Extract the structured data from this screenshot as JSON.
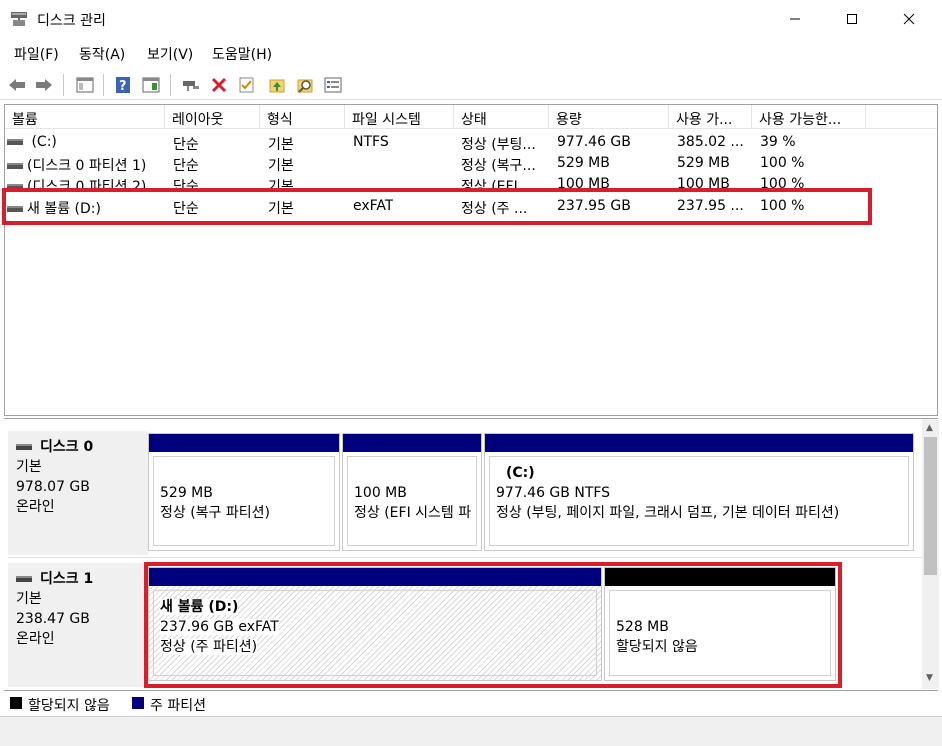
{
  "window": {
    "title": "디스크 관리"
  },
  "menu": [
    "파일(F)",
    "동작(A)",
    "보기(V)",
    "도움말(H)"
  ],
  "columns": [
    "볼륨",
    "레이아웃",
    "형식",
    "파일 시스템",
    "상태",
    "용량",
    "사용 가...",
    "사용 가능한..."
  ],
  "volumes": [
    {
      "name": "(C:)",
      "layout": "단순",
      "type": "기본",
      "fs": "NTFS",
      "status": "정상 (부팅...",
      "capacity": "977.46 GB",
      "free": "385.02 ...",
      "pct": "39 %"
    },
    {
      "name": "(디스크 0 파티션 1)",
      "layout": "단순",
      "type": "기본",
      "fs": "",
      "status": "정상 (복구...",
      "capacity": "529 MB",
      "free": "529 MB",
      "pct": "100 %"
    },
    {
      "name": "(디스크 0 파티션 2)",
      "layout": "단순",
      "type": "기본",
      "fs": "",
      "status": "정상 (EFI ...",
      "capacity": "100 MB",
      "free": "100 MB",
      "pct": "100 %"
    },
    {
      "name": "새 볼륨 (D:)",
      "layout": "단순",
      "type": "기본",
      "fs": "exFAT",
      "status": "정상 (주 ...",
      "capacity": "237.95 GB",
      "free": "237.95 ...",
      "pct": "100 %"
    }
  ],
  "disks": [
    {
      "name": "디스크 0",
      "kind": "기본",
      "size": "978.07 GB",
      "state": "온라인",
      "partitions": [
        {
          "title": "",
          "line1": "529 MB",
          "line2": "정상 (복구 파티션)"
        },
        {
          "title": "",
          "line1": "100 MB",
          "line2": "정상 (EFI 시스템 파"
        },
        {
          "title": "(C:)",
          "line1": "977.46 GB NTFS",
          "line2": "정상 (부팅, 페이지 파일, 크래시 덤프, 기본 데이터 파티션)"
        }
      ]
    },
    {
      "name": "디스크 1",
      "kind": "기본",
      "size": "238.47 GB",
      "state": "온라인",
      "partitions": [
        {
          "title": "새 볼륨  (D:)",
          "line1": "237.96 GB exFAT",
          "line2": "정상 (주 파티션)"
        },
        {
          "title": "",
          "line1": "528 MB",
          "line2": "할당되지 않음"
        }
      ]
    }
  ],
  "legend": [
    {
      "label": "할당되지 않음",
      "color": "#000000"
    },
    {
      "label": "주 파티션",
      "color": "#00007f"
    }
  ],
  "colors": {
    "primary_partition": "#00007f",
    "unallocated": "#000000",
    "highlight": "#d81e2a"
  }
}
